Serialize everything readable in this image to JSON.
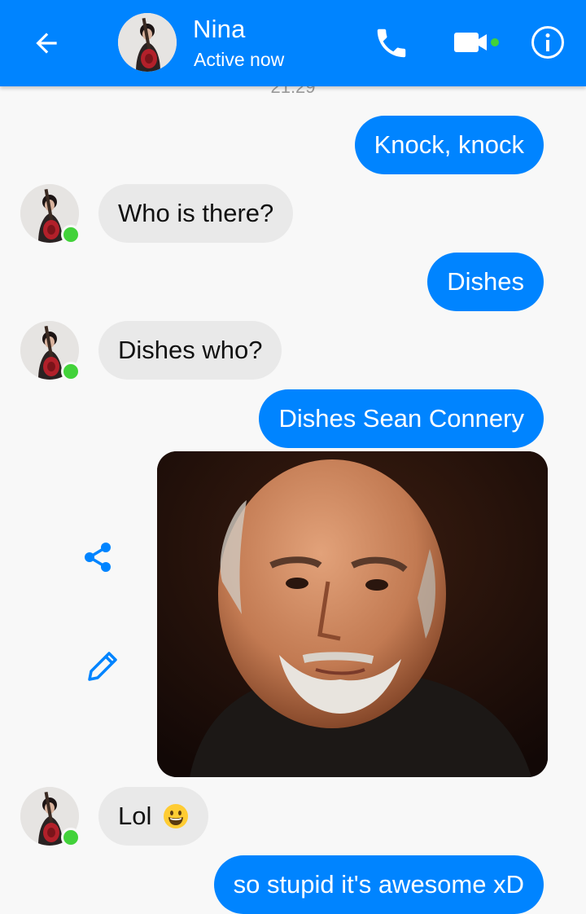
{
  "header": {
    "contact_name": "Nina",
    "status": "Active now",
    "icons": [
      "back-arrow-icon",
      "phone-icon",
      "video-camera-icon",
      "info-icon"
    ],
    "accent_color": "#0084ff",
    "online_dot_color": "#42d23a"
  },
  "conversation": {
    "timestamp": "21:29",
    "messages": [
      {
        "direction": "outgoing",
        "text": "Knock, knock"
      },
      {
        "direction": "incoming",
        "text": "Who is there?"
      },
      {
        "direction": "outgoing",
        "text": "Dishes"
      },
      {
        "direction": "incoming",
        "text": "Dishes who?"
      },
      {
        "direction": "outgoing",
        "text": "Dishes Sean Connery"
      },
      {
        "direction": "outgoing",
        "type": "image",
        "icons": [
          "share-icon",
          "edit-pencil-icon"
        ]
      },
      {
        "direction": "incoming",
        "text": "Lol",
        "emoji": "grinning-face-emoji"
      },
      {
        "direction": "outgoing",
        "text": "so stupid it's awesome xD"
      }
    ]
  }
}
